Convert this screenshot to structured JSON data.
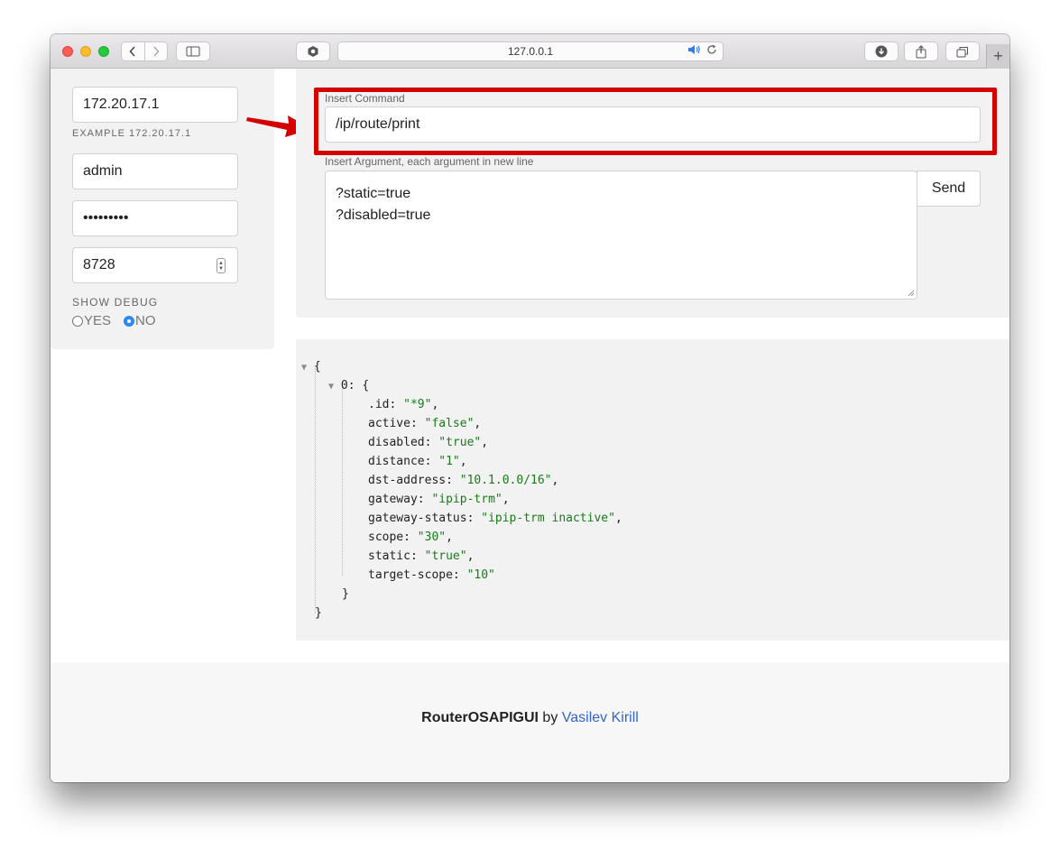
{
  "browser": {
    "address": "127.0.0.1",
    "new_tab_label": "+"
  },
  "connection": {
    "host_value": "172.20.17.1",
    "host_hint": "EXAMPLE 172.20.17.1",
    "username_value": "admin",
    "password_value": "•••••••••",
    "port_value": "8728",
    "debug_label": "SHOW DEBUG",
    "debug_options": [
      "YES",
      "NO"
    ],
    "debug_selected": "NO"
  },
  "command": {
    "command_label": "Insert Command",
    "command_value": "/ip/route/print",
    "argument_label": "Insert Argument, each argument in new line",
    "arguments": [
      "?static=true",
      "?disabled=true"
    ],
    "send_label": "Send"
  },
  "output": {
    "root_open": "{",
    "item_key": "0",
    "item_open": "{",
    "fields": [
      {
        "key": ".id",
        "value": "\"*9\""
      },
      {
        "key": "active",
        "value": "\"false\""
      },
      {
        "key": "disabled",
        "value": "\"true\""
      },
      {
        "key": "distance",
        "value": "\"1\""
      },
      {
        "key": "dst-address",
        "value": "\"10.1.0.0/16\""
      },
      {
        "key": "gateway",
        "value": "\"ipip-trm\""
      },
      {
        "key": "gateway-status",
        "value": "\"ipip-trm inactive\""
      },
      {
        "key": "scope",
        "value": "\"30\""
      },
      {
        "key": "static",
        "value": "\"true\""
      },
      {
        "key": "target-scope",
        "value": "\"10\""
      }
    ],
    "item_close": "}",
    "root_close": "}"
  },
  "footer": {
    "brand": "RouterOSAPIGUI",
    "by": " by ",
    "author": "Vasilev Kirill"
  },
  "colors": {
    "highlight": "#d40000",
    "link": "#3366cc",
    "json_string": "#1a7a1a",
    "radio_checked": "#2f86f7"
  }
}
